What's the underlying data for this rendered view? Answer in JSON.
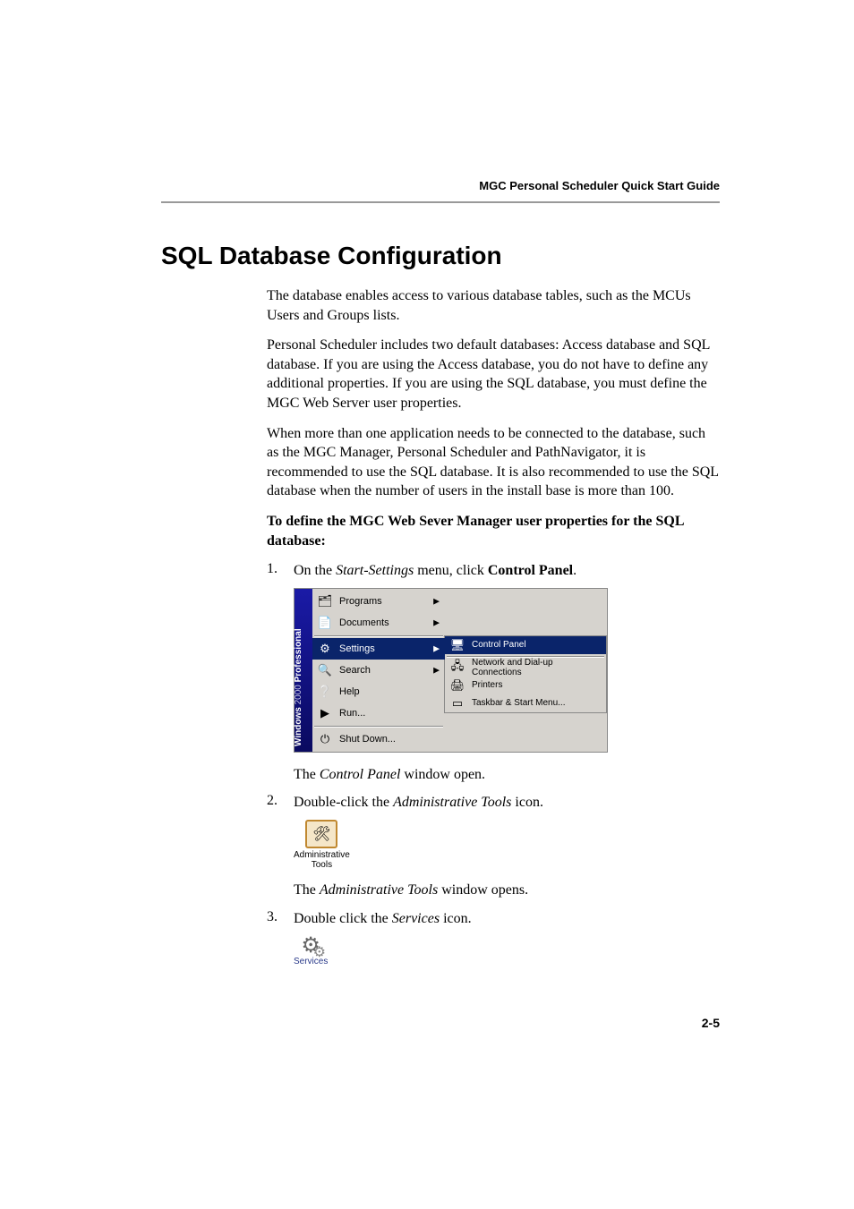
{
  "header": {
    "doc_title": "MGC Personal Scheduler Quick Start Guide"
  },
  "section": {
    "title": "SQL Database Configuration",
    "para1": "The database enables access to various database tables, such as the MCUs Users and Groups lists.",
    "para2": "Personal Scheduler includes two default databases: Access database and SQL database. If you are using the Access database, you do not have to define any additional properties. If you are using the SQL database, you must define the MGC Web Server user properties.",
    "para3": "When more than one application needs to be connected to the database, such as the MGC Manager, Personal Scheduler and PathNavigator, it is recommended to use the SQL database. It is also recommended to use the SQL database when the number of users in the install base is more than 100.",
    "proc_heading": "To define the MGC Web Sever Manager user properties for the SQL database:",
    "steps": {
      "s1": {
        "num": "1.",
        "pre": "On the ",
        "menu": "Start-Settings",
        "mid": " menu, click ",
        "target": "Control Panel",
        "post": ".",
        "followup_pre": "The ",
        "followup_em": "Control Panel",
        "followup_post": " window open."
      },
      "s2": {
        "num": "2.",
        "pre": "Double-click the ",
        "target": "Administrative Tools",
        "post": " icon.",
        "followup_pre": "The ",
        "followup_em": "Administrative Tools",
        "followup_post": " window opens."
      },
      "s3": {
        "num": "3.",
        "pre": "Double click the ",
        "target": "Services",
        "post": " icon."
      }
    }
  },
  "startmenu": {
    "brand_bold": "Windows",
    "brand_light": " 2000 ",
    "brand_bold2": "Professional",
    "items": {
      "programs": "Programs",
      "documents": "Documents",
      "settings": "Settings",
      "search": "Search",
      "help": "Help",
      "run": "Run...",
      "shutdown": "Shut Down..."
    },
    "submenu": {
      "control_panel": "Control Panel",
      "network": "Network and Dial-up Connections",
      "printers": "Printers",
      "taskbar": "Taskbar & Start Menu..."
    }
  },
  "admin_tools_label": "Administrative\nTools",
  "services_label": "Services",
  "page_number": "2-5"
}
